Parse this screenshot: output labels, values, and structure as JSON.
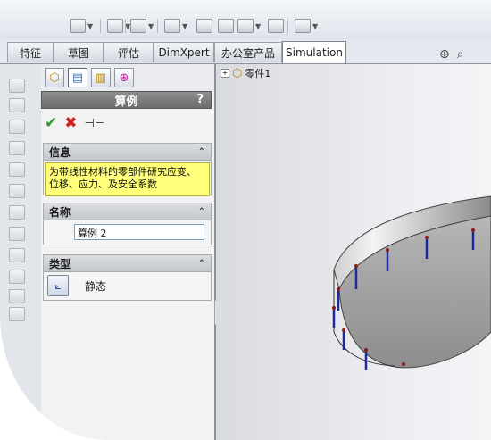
{
  "tabs": [
    "特征",
    "草图",
    "评估",
    "DimXpert",
    "办公室产品",
    "Simulation"
  ],
  "active_tab": "Simulation",
  "property_manager": {
    "title": "算例",
    "help_label": "?",
    "groups": {
      "info": {
        "header": "信息",
        "message": "为带线性材料的零部件研究应变、位移、应力、及安全系数"
      },
      "name": {
        "header": "名称",
        "value": "算例 2"
      },
      "type": {
        "header": "类型",
        "selected": "静态"
      }
    }
  },
  "feature_tree": {
    "root_label": "零件1"
  },
  "icons": {
    "ok": "checkmark-icon",
    "cancel": "x-icon",
    "pin": "pushpin-icon",
    "feature_manager_tab": "feature-manager-icon",
    "property_manager_tab": "property-manager-icon",
    "config_manager_tab": "configuration-manager-icon",
    "dim_xpert_tab": "crosshair-icon",
    "static_study": "static-study-icon",
    "part": "part-icon"
  },
  "colors": {
    "info_background": "#ffff7a",
    "title_bar": "#7a7a7a",
    "fixture_arrows": "#1c2a9c"
  }
}
